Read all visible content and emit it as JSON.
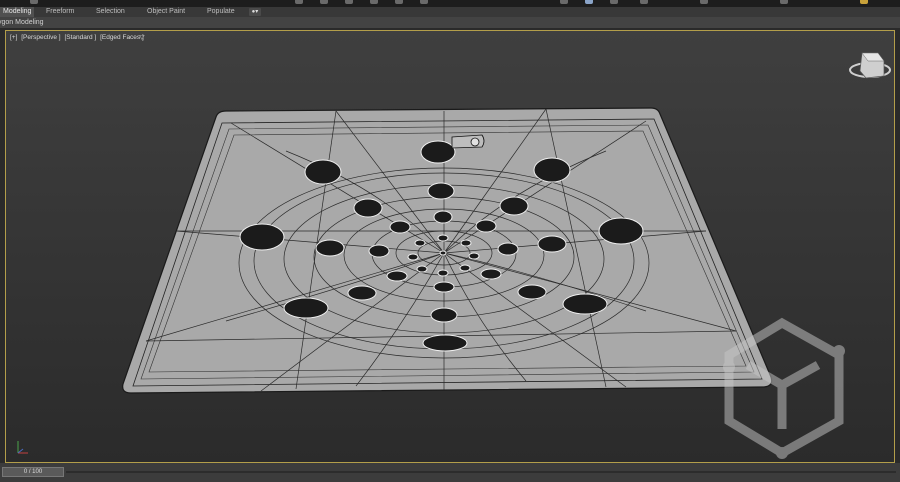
{
  "ribbon": {
    "tabs": [
      {
        "label": "Modeling",
        "active": true
      },
      {
        "label": "Freeform",
        "active": false
      },
      {
        "label": "Selection",
        "active": false
      },
      {
        "label": "Object Paint",
        "active": false
      },
      {
        "label": "Populate",
        "active": false
      }
    ],
    "subpanel_label": "ygon Modeling"
  },
  "viewport": {
    "labels": [
      "[+]",
      "[Perspective ]",
      "[Standard ]",
      "[Edged Faces ]"
    ],
    "mode": "Edged Faces"
  },
  "timeline": {
    "frame_text": "0 / 100"
  },
  "colors": {
    "viewport_border": "#b39e4a",
    "model_fill": "#a8a8a8"
  }
}
